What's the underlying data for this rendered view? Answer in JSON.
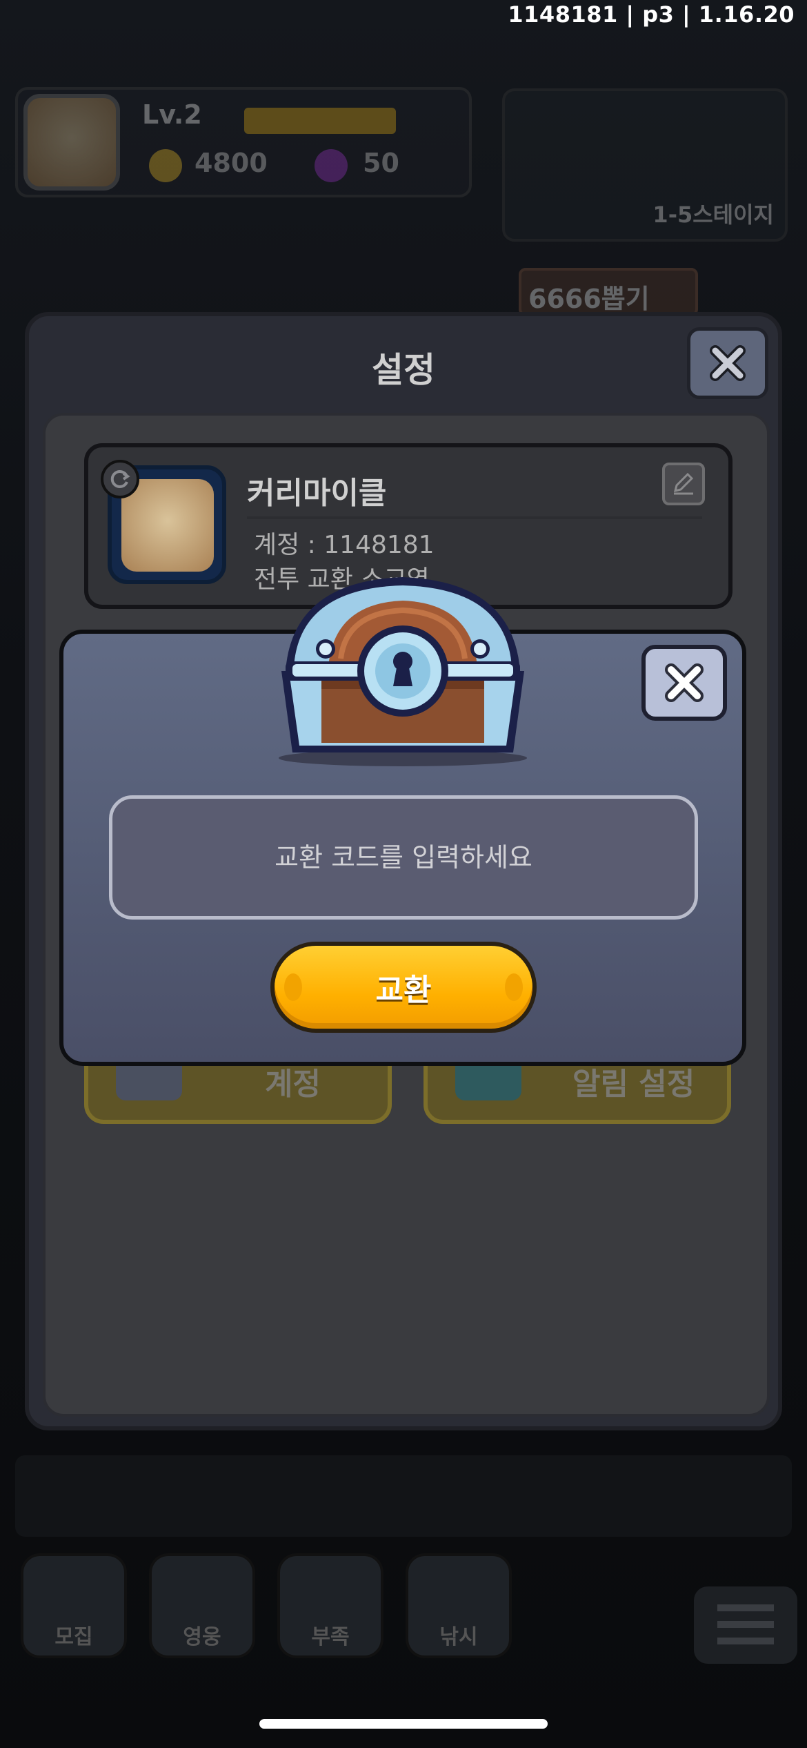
{
  "version_label": "1148181 | p3 | 1.16.20",
  "hud": {
    "level": "Lv.2",
    "coins": "4800",
    "gems": "50",
    "stage": "1-5스테이지",
    "banner": "6666뽑기"
  },
  "settings": {
    "title": "설정",
    "profile": {
      "name": "커리마이클",
      "account": "계정 : 1148181",
      "combat": "전투 교환 소교역"
    },
    "buttons": {
      "account_label": "계정",
      "notify_label": "알림 설정"
    }
  },
  "bottom_nav": [
    {
      "label": "모집"
    },
    {
      "label": "영웅"
    },
    {
      "label": "부족"
    },
    {
      "label": "낚시"
    }
  ],
  "redeem_dialog": {
    "placeholder": "교환 코드를 입력하세요",
    "button_label": "교환"
  },
  "colors": {
    "dialog_bg": "#555d76",
    "button_yellow": "#ffb000",
    "input_border": "#b9bccb"
  }
}
